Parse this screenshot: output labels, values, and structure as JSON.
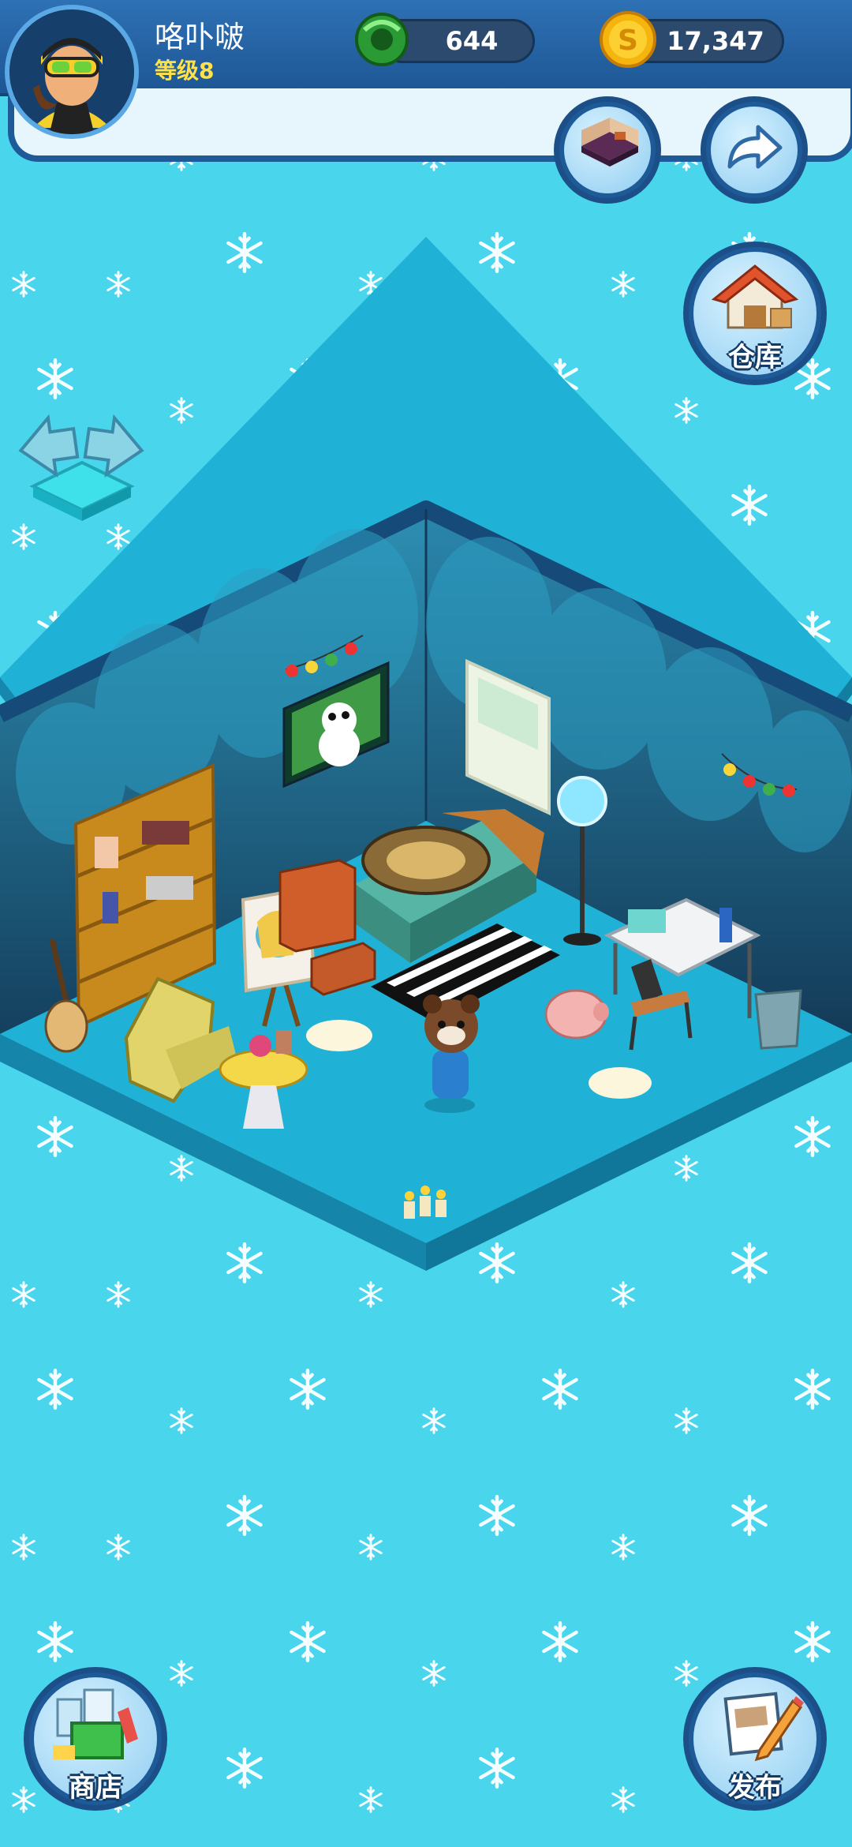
{
  "player": {
    "name": "咯卟啵",
    "level": "等级8"
  },
  "currencies": {
    "gems": "644",
    "coins": "17,347"
  },
  "buttons": {
    "warehouse": "仓库",
    "shop": "商店",
    "publish": "发布"
  },
  "icons": {
    "gem": "green-gem-icon",
    "coin": "gold-coin-icon",
    "room": "room-layout-icon",
    "back": "back-arrow-icon",
    "warehouse": "house-icon",
    "shop": "shop-icon",
    "publish": "publish-pencil-icon",
    "rotate": "rotate-room-icon"
  },
  "colors": {
    "background": "#49d6ec",
    "hud": "#1f5a98",
    "level": "#ffe14a",
    "floor": "#1fb2d6",
    "wall": "#1c4f71"
  }
}
